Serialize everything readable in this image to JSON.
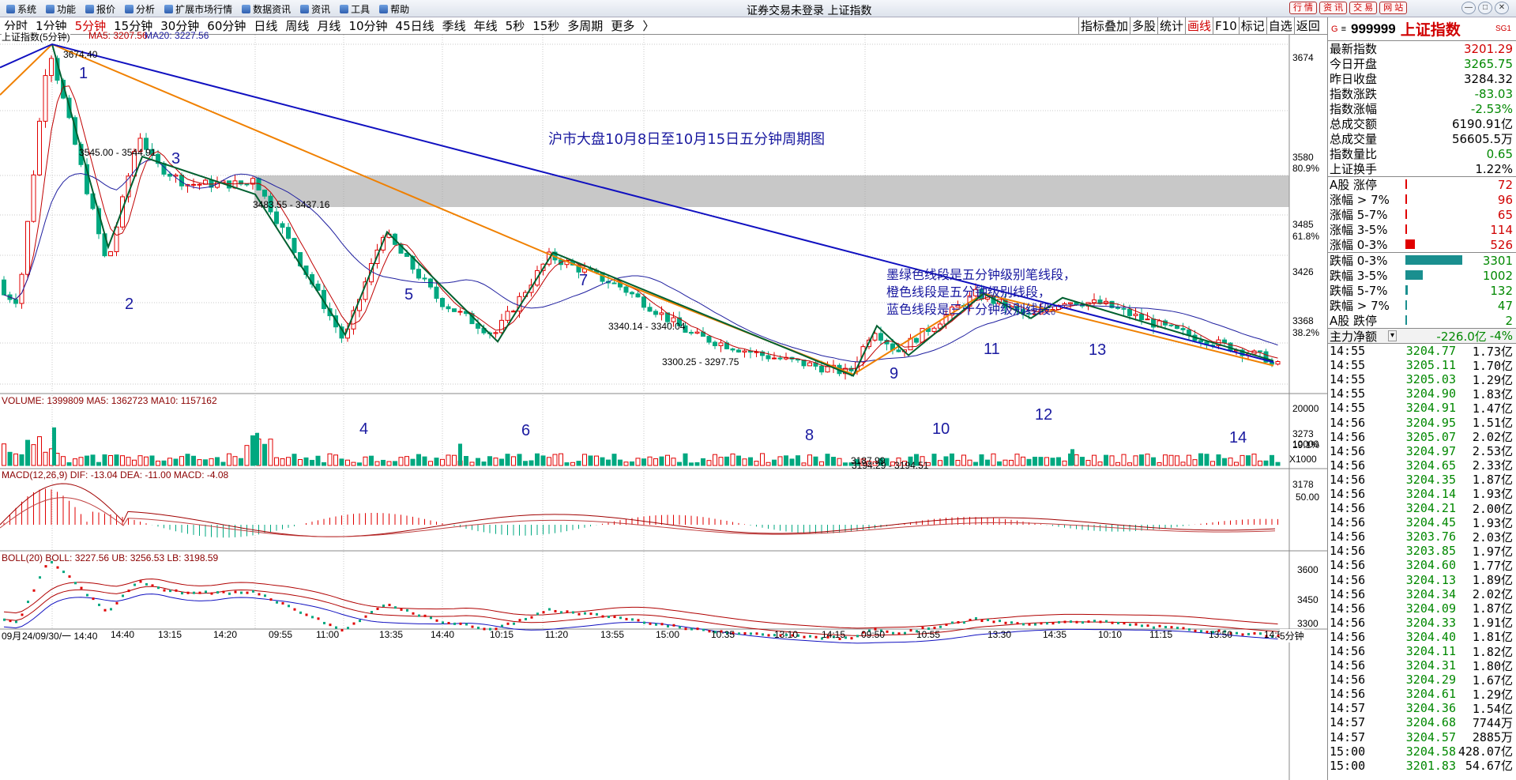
{
  "menu": [
    "系统",
    "功能",
    "报价",
    "分析",
    "扩展市场行情",
    "数据资讯",
    "资讯",
    "工具",
    "帮助"
  ],
  "window_title": "证券交易未登录  上证指数",
  "quick_buttons": [
    "行 情",
    "资 讯",
    "交 易",
    "网 站"
  ],
  "window_controls": [
    "—",
    "□",
    "✕"
  ],
  "period_tabs": [
    "分时",
    "1分钟",
    "5分钟",
    "15分钟",
    "30分钟",
    "60分钟",
    "日线",
    "周线",
    "月线",
    "10分钟",
    "45日线",
    "季线",
    "年线",
    "5秒",
    "15秒",
    "多周期",
    "更多",
    "〉"
  ],
  "active_tab": "5分钟",
  "right_tools": [
    "指标叠加",
    "多股",
    "统计",
    "画线",
    "F10",
    "标记",
    "自选",
    "返回"
  ],
  "active_tool": "画线",
  "kline": {
    "header_name": "上证指数(5分钟)",
    "ma5": "MA5: 3207.56",
    "ma20": "MA20: 3227.56",
    "annotation_title": "沪市大盘10月8日至10月15日五分钟周期图",
    "legend_lines": [
      "墨绿色线段是五分钟级别笔线段，",
      "橙色线段是五分钟级别线段，",
      "蓝色线段是三十分钟级别线段。"
    ],
    "price_labels": [
      "3674.40",
      "3545.00 - 3544.91",
      "3483.55 - 3437.16",
      "3340.14 - 3340.04",
      "3300.25 - 3297.75",
      "3194.29 - 3194.51",
      "3187.99"
    ],
    "stroke_numbers": [
      "1",
      "2",
      "3",
      "4",
      "5",
      "6",
      "7",
      "8",
      "9",
      "10",
      "11",
      "12",
      "13",
      "14"
    ],
    "y_axis": [
      "3674",
      "3580",
      "80.9%",
      "3485",
      "61.8%",
      "3426",
      "3368",
      "38.2%",
      "3273",
      "19.1%",
      "3178"
    ]
  },
  "volume": {
    "header": "VOLUME: 1399809  MA5: 1362723  MA10: 1157162",
    "y_axis": [
      "20000",
      "10000",
      "X1000"
    ]
  },
  "macd": {
    "header": "MACD(12,26,9)  DIF: -13.04  DEA: -11.00  MACD: -4.08",
    "y_axis": [
      "50.00"
    ]
  },
  "boll": {
    "header": "BOLL(20)  BOLL: 3227.56  UB: 3256.53  LB: 3198.59",
    "y_axis": [
      "3600",
      "3450",
      "3300"
    ]
  },
  "x_axis": [
    "09月",
    "24/09/30/一 14:40",
    "14:40",
    "13:15",
    "14:20",
    "09:55",
    "11:00",
    "13:35",
    "14:40",
    "10:15",
    "11:20",
    "13:55",
    "15:00",
    "10:35",
    "13:10",
    "14:15",
    "09:50",
    "10:55",
    "13:30",
    "14:35",
    "10:10",
    "11:15",
    "13:50",
    "14:5"
  ],
  "x_axis_period": "5分钟",
  "quote": {
    "badge": "SG1",
    "code": "999999",
    "name": "上证指数",
    "rows": [
      {
        "k": "最新指数",
        "v": "3201.29",
        "c": "red"
      },
      {
        "k": "今日开盘",
        "v": "3265.75",
        "c": "green"
      },
      {
        "k": "昨日收盘",
        "v": "3284.32",
        "c": ""
      },
      {
        "k": "指数涨跌",
        "v": "-83.03",
        "c": "green"
      },
      {
        "k": "指数涨幅",
        "v": "-2.53%",
        "c": "green"
      },
      {
        "k": "总成交额",
        "v": "6190.91亿",
        "c": ""
      },
      {
        "k": "总成交量",
        "v": "56605.5万",
        "c": ""
      },
      {
        "k": "指数量比",
        "v": "0.65",
        "c": "green"
      },
      {
        "k": "上证换手",
        "v": "1.22%",
        "c": ""
      }
    ],
    "breadth_up": [
      {
        "k": "A股 涨停",
        "v": "72",
        "frac": 0.01
      },
      {
        "k": "涨幅 > 7%",
        "v": "96",
        "frac": 0.01
      },
      {
        "k": "涨幅 5-7%",
        "v": "65",
        "frac": 0.01
      },
      {
        "k": "涨幅 3-5%",
        "v": "114",
        "frac": 0.01
      },
      {
        "k": "涨幅 0-3%",
        "v": "526",
        "frac": 0.16
      }
    ],
    "breadth_down": [
      {
        "k": "跌幅 0-3%",
        "v": "3301",
        "frac": 1.0
      },
      {
        "k": "跌幅 3-5%",
        "v": "1002",
        "frac": 0.3
      },
      {
        "k": "跌幅 5-7%",
        "v": "132",
        "frac": 0.04
      },
      {
        "k": "跌幅 > 7%",
        "v": "47",
        "frac": 0.01
      },
      {
        "k": "A股 跌停",
        "v": "2",
        "frac": 0.005
      }
    ],
    "net_flow_label": "主力净额",
    "net_flow_value": "-226.0亿",
    "net_flow_pct": "-4%",
    "ticks": [
      [
        "14:55",
        "3204.77",
        "1.73亿"
      ],
      [
        "14:55",
        "3205.11",
        "1.70亿"
      ],
      [
        "14:55",
        "3205.03",
        "1.29亿"
      ],
      [
        "14:55",
        "3204.90",
        "1.83亿"
      ],
      [
        "14:55",
        "3204.91",
        "1.47亿"
      ],
      [
        "14:56",
        "3204.95",
        "1.51亿"
      ],
      [
        "14:56",
        "3205.07",
        "2.02亿"
      ],
      [
        "14:56",
        "3204.97",
        "2.53亿"
      ],
      [
        "14:56",
        "3204.65",
        "2.33亿"
      ],
      [
        "14:56",
        "3204.35",
        "1.87亿"
      ],
      [
        "14:56",
        "3204.14",
        "1.93亿"
      ],
      [
        "14:56",
        "3204.21",
        "2.00亿"
      ],
      [
        "14:56",
        "3204.45",
        "1.93亿"
      ],
      [
        "14:56",
        "3203.76",
        "2.03亿"
      ],
      [
        "14:56",
        "3203.85",
        "1.97亿"
      ],
      [
        "14:56",
        "3204.60",
        "1.77亿"
      ],
      [
        "14:56",
        "3204.13",
        "1.89亿"
      ],
      [
        "14:56",
        "3204.34",
        "2.02亿"
      ],
      [
        "14:56",
        "3204.09",
        "1.87亿"
      ],
      [
        "14:56",
        "3204.33",
        "1.91亿"
      ],
      [
        "14:56",
        "3204.40",
        "1.81亿"
      ],
      [
        "14:56",
        "3204.11",
        "1.82亿"
      ],
      [
        "14:56",
        "3204.31",
        "1.80亿"
      ],
      [
        "14:56",
        "3204.29",
        "1.67亿"
      ],
      [
        "14:56",
        "3204.61",
        "1.29亿"
      ],
      [
        "14:57",
        "3204.36",
        "1.54亿"
      ],
      [
        "14:57",
        "3204.68",
        "7744万"
      ],
      [
        "14:57",
        "3204.57",
        "2885万"
      ],
      [
        "15:00",
        "3204.58",
        "428.07亿"
      ],
      [
        "15:00",
        "3201.83",
        "54.67亿"
      ]
    ]
  }
}
